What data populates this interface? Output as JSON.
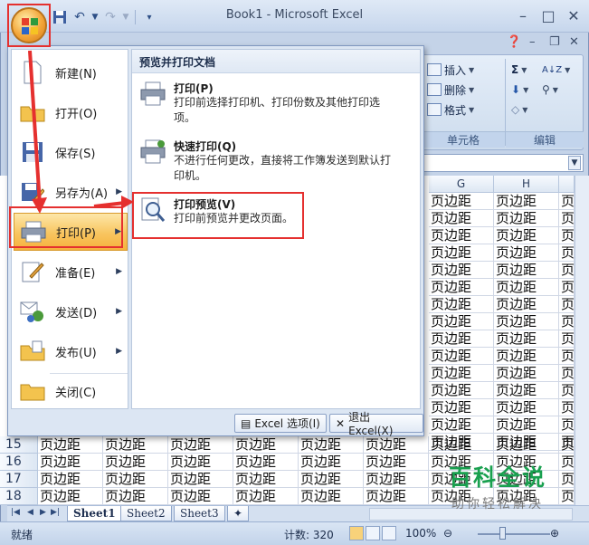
{
  "window": {
    "title": "Book1 - Microsoft Excel"
  },
  "qat": {
    "save_icon": "save-icon",
    "undo_icon": "undo-icon",
    "redo_icon": "redo-icon",
    "customize_icon": "customize-qat-icon"
  },
  "ribbon": {
    "groups": [
      {
        "label": "单元格",
        "items": [
          "插入",
          "删除",
          "格式"
        ]
      },
      {
        "label": "编辑",
        "items": [
          "Σ",
          "A Z",
          "",
          "",
          ""
        ]
      }
    ]
  },
  "office_menu": {
    "left_items": [
      {
        "label": "新建(N)",
        "icon": "new-document-icon",
        "has_arrow": false
      },
      {
        "label": "打开(O)",
        "icon": "open-folder-icon",
        "has_arrow": false
      },
      {
        "label": "保存(S)",
        "icon": "save-disk-icon",
        "has_arrow": false
      },
      {
        "label": "另存为(A)",
        "icon": "save-as-icon",
        "has_arrow": true
      },
      {
        "label": "打印(P)",
        "icon": "printer-icon",
        "has_arrow": true,
        "active": true
      },
      {
        "label": "准备(E)",
        "icon": "prepare-icon",
        "has_arrow": true
      },
      {
        "label": "发送(D)",
        "icon": "send-icon",
        "has_arrow": true
      },
      {
        "label": "发布(U)",
        "icon": "publish-icon",
        "has_arrow": true
      },
      {
        "label": "关闭(C)",
        "icon": "close-folder-icon",
        "has_arrow": false
      }
    ],
    "right_header": "预览并打印文档",
    "right_items": [
      {
        "title": "打印(P)",
        "desc": "打印前选择打印机、打印份数及其他打印选项。",
        "icon": "printer-icon"
      },
      {
        "title": "快速打印(Q)",
        "desc": "不进行任何更改，直接将工作簿发送到默认打印机。",
        "icon": "quick-print-icon"
      },
      {
        "title": "打印预览(V)",
        "desc": "打印前预览并更改页面。",
        "icon": "print-preview-icon"
      }
    ],
    "footer": {
      "options": "Excel 选项(I)",
      "exit": "退出 Excel(X)"
    }
  },
  "grid": {
    "columns_visible": [
      "G",
      "H"
    ],
    "cell_text": "页边距",
    "row_numbers": [
      "15",
      "16",
      "17",
      "18"
    ]
  },
  "sheets": [
    "Sheet1",
    "Sheet2",
    "Sheet3"
  ],
  "status": {
    "ready": "就绪",
    "count": "计数: 320",
    "zoom": "100%"
  },
  "watermark": {
    "title": "百科全说",
    "subtitle": "助你轻松解决"
  },
  "colors": {
    "highlight": "#e5302f",
    "active_menu": "#f8c55f",
    "accent": "#2e4f86"
  }
}
